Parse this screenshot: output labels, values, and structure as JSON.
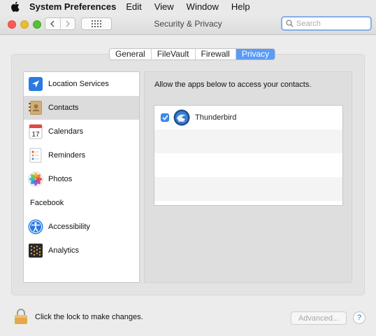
{
  "menubar": {
    "app_name": "System Preferences",
    "items": [
      "Edit",
      "View",
      "Window",
      "Help"
    ]
  },
  "window": {
    "title": "Security & Privacy",
    "search_placeholder": "Search"
  },
  "tabs": [
    {
      "label": "General",
      "active": false
    },
    {
      "label": "FileVault",
      "active": false
    },
    {
      "label": "Firewall",
      "active": false
    },
    {
      "label": "Privacy",
      "active": true
    }
  ],
  "sidebar": {
    "items": [
      {
        "label": "Location Services",
        "icon": "location-arrow-icon",
        "selected": false
      },
      {
        "label": "Contacts",
        "icon": "contacts-book-icon",
        "selected": true
      },
      {
        "label": "Calendars",
        "icon": "calendar-icon",
        "selected": false
      },
      {
        "label": "Reminders",
        "icon": "reminders-icon",
        "selected": false
      },
      {
        "label": "Photos",
        "icon": "photos-flower-icon",
        "selected": false
      },
      {
        "label": "Facebook",
        "icon": null,
        "selected": false
      },
      {
        "label": "Accessibility",
        "icon": "accessibility-icon",
        "selected": false
      },
      {
        "label": "Analytics",
        "icon": "analytics-icon",
        "selected": false
      }
    ],
    "calendar_day": "17"
  },
  "pane": {
    "label": "Allow the apps below to access your contacts.",
    "apps": [
      {
        "name": "Thunderbird",
        "checked": true,
        "icon": "thunderbird-icon"
      }
    ]
  },
  "footer": {
    "lock_text": "Click the lock to make changes.",
    "advanced_label": "Advanced...",
    "help_label": "?"
  },
  "colors": {
    "accent": "#5a9bf6",
    "checkbox": "#3d8cf3"
  }
}
